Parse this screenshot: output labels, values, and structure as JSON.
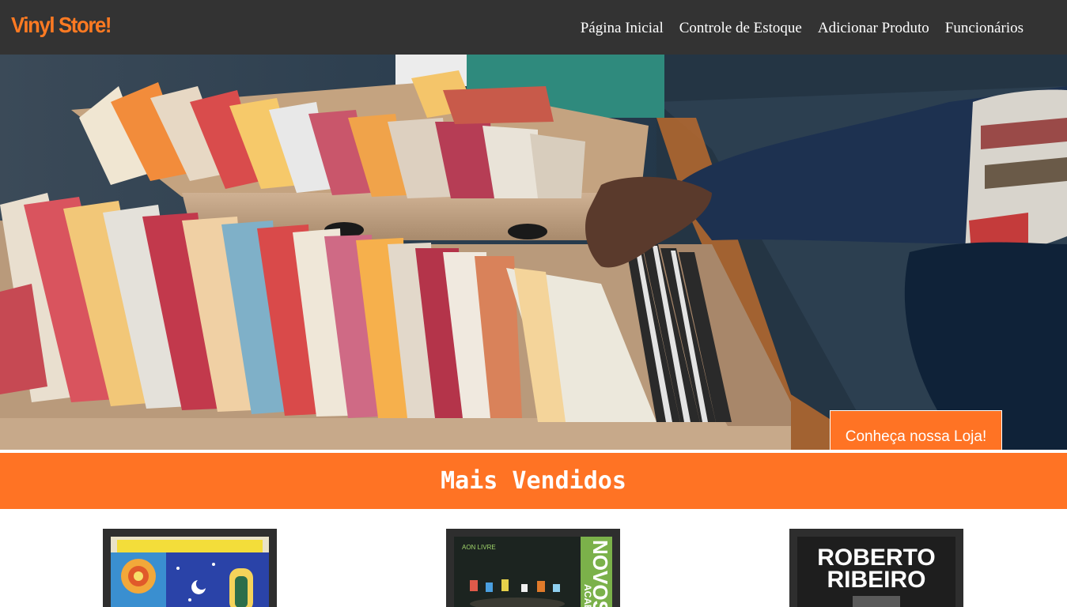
{
  "header": {
    "brand": "Vinyl Store!",
    "nav": [
      {
        "label": "Página Inicial"
      },
      {
        "label": "Controle de Estoque"
      },
      {
        "label": "Adicionar Produto"
      },
      {
        "label": "Funcionários"
      }
    ]
  },
  "hero": {
    "cta_label": "Conheça nossa Loja!"
  },
  "best_sellers": {
    "title": "Mais Vendidos",
    "products": [
      {
        "cover_icon": "album-cover-cosmic-art-icon"
      },
      {
        "cover_icon": "album-cover-novos-acabou-icon",
        "cover_text": "NOVOS",
        "cover_small": "ACABO",
        "cover_top": "AON LIVRE"
      },
      {
        "cover_icon": "album-cover-roberto-ribeiro-icon",
        "cover_text_line1": "ROBERTO",
        "cover_text_line2": "RIBEIRO"
      }
    ]
  },
  "colors": {
    "accent": "#ff7324",
    "header_bg": "#333333",
    "brand": "#ff7a22"
  }
}
